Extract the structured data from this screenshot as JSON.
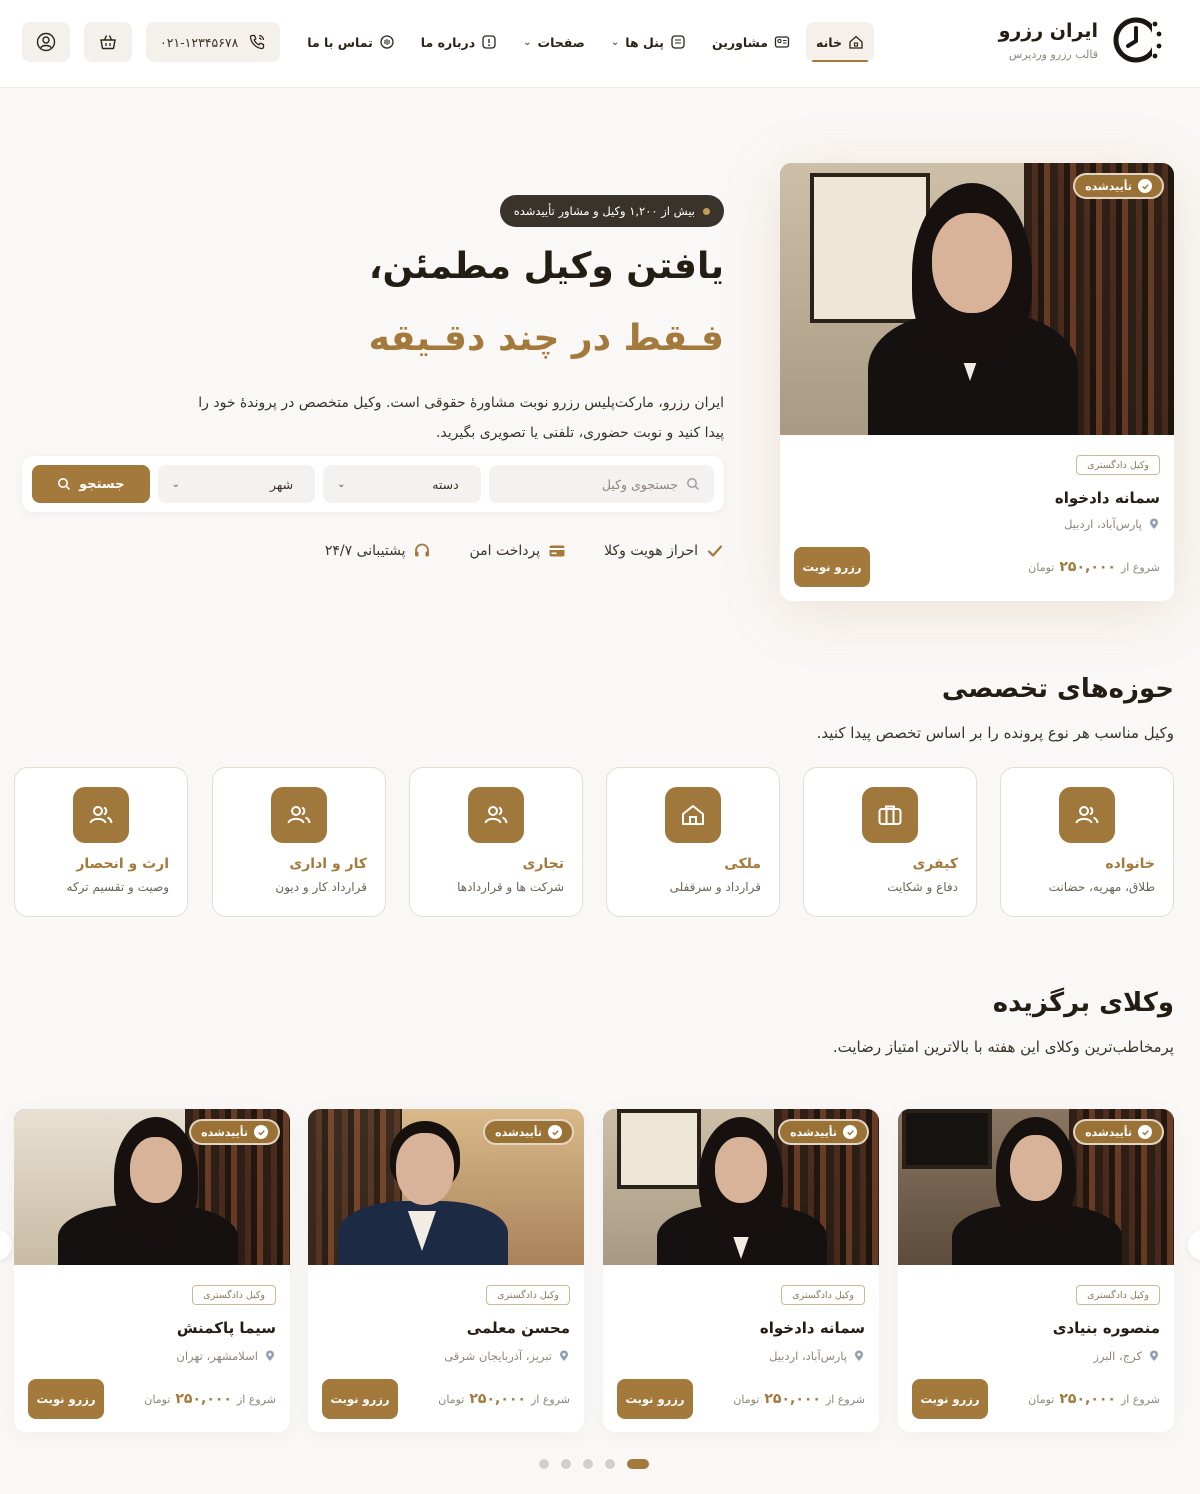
{
  "header": {
    "brand_title": "ایران رزرو",
    "brand_sub": "قالب رزرو وردپرس",
    "nav": [
      {
        "label": "خانه",
        "icon": "home-icon",
        "active": true
      },
      {
        "label": "مشاورین",
        "icon": "advisors-icon"
      },
      {
        "label": "پنل ها",
        "icon": "panel-icon",
        "dropdown": true
      },
      {
        "label": "صفحات",
        "dropdown": true
      },
      {
        "label": "درباره ما",
        "icon": "info-icon"
      },
      {
        "label": "تماس با ما",
        "icon": "contact-icon"
      }
    ],
    "phone": "۰۲۱-۱۲۳۴۵۶۷۸"
  },
  "hero": {
    "badge": "بیش از ۱,۲۰۰ وکیل و مشاور تأییدشده",
    "title_line1": "یافتن وکیل مطمئن،",
    "title_line2": "فـقط در چند دقـیقه",
    "desc_line1": "ایران رزرو، مارکت‌پلیس رزرو نوبت مشاورهٔ حقوقی است. وکیل متخصص در پروندهٔ خود را",
    "desc_line2": "پیدا کنید و نوبت حضوری، تلفنی یا تصویری بگیرید.",
    "search": {
      "placeholder": "جستجوی وکیل",
      "category": "دسته",
      "city": "شهر",
      "button": "جستجو"
    },
    "features": [
      {
        "label": "احراز هویت وکلا",
        "icon": "check-icon"
      },
      {
        "label": "پرداخت امن",
        "icon": "card-icon"
      },
      {
        "label": "پشتیبانی ۲۴/۷",
        "icon": "headset-icon"
      }
    ]
  },
  "featured_card": {
    "badge": "تأییدشده",
    "tag": "وکیل دادگستری",
    "name": "سمانه دادخواه",
    "location": "پارس‌آباد، اردبیل",
    "price_prefix": "شروع از",
    "price": "۲۵۰,۰۰۰",
    "currency": "تومان",
    "button": "رزرو نوبت"
  },
  "specialties": {
    "title": "حوزه‌های تخصصی",
    "subtitle": "وکیل مناسب هر نوع پرونده را بر اساس تخصص پیدا کنید.",
    "items": [
      {
        "title": "خانواده",
        "sub": "طلاق، مهریه، حضانت",
        "icon": "people-icon"
      },
      {
        "title": "کیفری",
        "sub": "دفاع و شکایت",
        "icon": "briefcase-icon"
      },
      {
        "title": "ملکی",
        "sub": "قرارداد و سرقفلی",
        "icon": "house-icon"
      },
      {
        "title": "تجاری",
        "sub": "شرکت ها و قراردادها",
        "icon": "people-icon"
      },
      {
        "title": "کار و اداری",
        "sub": "قرارداد کار و دیون",
        "icon": "people-icon"
      },
      {
        "title": "ارث و انحصار",
        "sub": "وصیت و تقسیم ترکه",
        "icon": "people-icon"
      }
    ]
  },
  "top_lawyers": {
    "title": "وکلای برگزیده",
    "subtitle": "پرمخاطب‌ترین وکلای این هفته با بالاترین امتیاز رضایت.",
    "cards": [
      {
        "badge": "تأییدشده",
        "tag": "وکیل دادگستری",
        "name": "منصوره بنیادی",
        "location": "کرج، البرز",
        "price_prefix": "شروع از",
        "price": "۲۵۰,۰۰۰",
        "currency": "تومان",
        "button": "رزرو نوبت"
      },
      {
        "badge": "تأییدشده",
        "tag": "وکیل دادگستری",
        "name": "سمانه دادخواه",
        "location": "پارس‌آباد، اردبیل",
        "price_prefix": "شروع از",
        "price": "۲۵۰,۰۰۰",
        "currency": "تومان",
        "button": "رزرو نوبت"
      },
      {
        "badge": "تأییدشده",
        "tag": "وکیل دادگستری",
        "name": "محسن معلمی",
        "location": "تبریز، آذربایجان شرقی",
        "price_prefix": "شروع از",
        "price": "۲۵۰,۰۰۰",
        "currency": "تومان",
        "button": "رزرو نوبت"
      },
      {
        "badge": "تأییدشده",
        "tag": "وکیل دادگستری",
        "name": "سیما پاکمنش",
        "location": "اسلامشهر، تهران",
        "price_prefix": "شروع از",
        "price": "۲۵۰,۰۰۰",
        "currency": "تومان",
        "button": "رزرو نوبت"
      }
    ],
    "pagination": {
      "pages": 5,
      "active": 5
    }
  },
  "colors": {
    "brand": "#a47a3c",
    "ink": "#241d14",
    "background": "#faf8f6"
  }
}
